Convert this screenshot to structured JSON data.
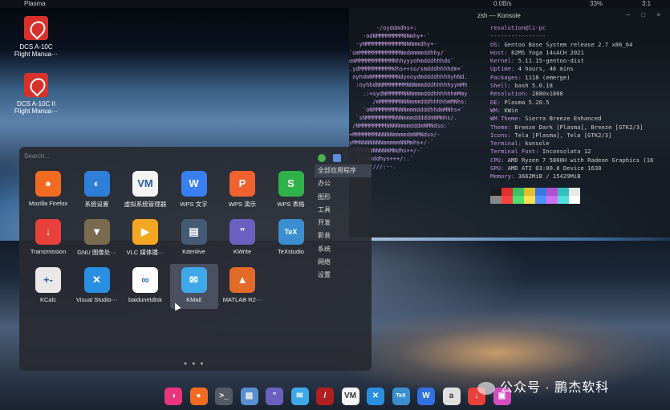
{
  "topbar": {
    "label": "Plasma",
    "stat1": "0.0B/s",
    "stat2": "33%",
    "stat3": "3:1"
  },
  "desktop": {
    "icons": [
      {
        "label1": "DCS A-10C",
        "label2": "Flight Manua···"
      },
      {
        "label1": "DCS A-10C II",
        "label2": "Flight Manua···"
      }
    ]
  },
  "konsole": {
    "title": "zsh — Konsole",
    "window_buttons": "– □ ×",
    "ascii_art": "        -/oyddmdhs+:\n    -odNMMMMMMMMNNmhy+-`\n  -yNMMMMMMMMMMMNNNmmdhy+-\n`omMMMMMMMMMMMMNmdmmmmddhhy/`\nomMMMMMMMMMMMNhhyyyohmdddhhhdo`\n.ydMMMMMMMMMMdhs++so/smdddhhhhdm+`\n oyhdmNMMMMMMMNdyooydmddddhhhhyhNd.\n  :oyhhdNNMMMMMMMNNNmmdddhhhhhyymMh\n    .:+sydNMMMMMNNNmmmdddhhhhhhmMmy\n       /mMMMMMMNNNmmmdddhhhhhmMNhs:\n    `oNMMMMMMMNNNmmmddddhhdmMNhs+`\n  `sNMMMMMMMMNNNmmmdddddmNMmhs/.\n /NMMMMMMMMNNNNmmmdddmNMNdso:`\n+MMMMMMMNNNNNmmmmdmNMNdso/-\nyMMNNNNNNNmmmmmNNMmhs+/-`\n/hMMNNNNNNNNMNdhs++/-`\n`/ohdmmddhys+++/:.`\n  `-//////:--.",
    "info": [
      {
        "k": "resolution@li-pc",
        "v": ""
      },
      {
        "k": "----------------",
        "v": ""
      },
      {
        "k": "OS",
        "v": "Gentoo Base System release 2.7 x86_64"
      },
      {
        "k": "Host",
        "v": "82MS Yoga 14sACH 2021"
      },
      {
        "k": "Kernel",
        "v": "5.11.15-gentoo-dist"
      },
      {
        "k": "Uptime",
        "v": "4 hours, 46 mins"
      },
      {
        "k": "Packages",
        "v": "1118 (emerge)"
      },
      {
        "k": "Shell",
        "v": "bash 5.0.18"
      },
      {
        "k": "Resolution",
        "v": "2880x1800"
      },
      {
        "k": "DE",
        "v": "Plasma 5.20.5"
      },
      {
        "k": "WM",
        "v": "KWin"
      },
      {
        "k": "WM Theme",
        "v": "Sierra Breeze Enhanced"
      },
      {
        "k": "Theme",
        "v": "Breeze Dark [Plasma], Breeze [GTK2/3]"
      },
      {
        "k": "Icons",
        "v": "Tela [Plasma], Tela [GTK2/3]"
      },
      {
        "k": "Terminal",
        "v": "konsole"
      },
      {
        "k": "Terminal Font",
        "v": "Inconsolata 12"
      },
      {
        "k": "CPU",
        "v": "AMD Ryzen 7 5800H with Radeon Graphics (16"
      },
      {
        "k": "GPU",
        "v": "AMD ATI 03:00.0 Device 1638"
      },
      {
        "k": "Memory",
        "v": "3662MiB / 15429MiB"
      }
    ],
    "swatch_colors_top": [
      "#1a1a1a",
      "#e03030",
      "#3cc060",
      "#e0c030",
      "#3a78e0",
      "#b050d0",
      "#30c0c0",
      "#e8e8e8"
    ],
    "swatch_colors_bottom": [
      "#888888",
      "#ff4040",
      "#50e070",
      "#ffe050",
      "#5090ff",
      "#d070f0",
      "#50e0e0",
      "#ffffff"
    ]
  },
  "launcher": {
    "search_placeholder": "Search...",
    "categories": [
      "全部应用程序",
      "办公",
      "图形",
      "工具",
      "开发",
      "影音",
      "系统",
      "网络",
      "设置"
    ],
    "apps": [
      {
        "label": "Mozilla Firefox",
        "icon": "firefox-icon",
        "color": "#f26b21",
        "glyph": "●"
      },
      {
        "label": "系统设置",
        "icon": "system-settings-icon",
        "color": "#2f7fd8",
        "glyph": "◐"
      },
      {
        "label": "虚拟系统管理器",
        "icon": "virt-manager-icon",
        "color": "#f4f4f4",
        "glyph": "VM"
      },
      {
        "label": "WPS 文字",
        "icon": "wps-writer-icon",
        "color": "#3a7ff0",
        "glyph": "W"
      },
      {
        "label": "WPS 演示",
        "icon": "wps-presentation-icon",
        "color": "#f0622f",
        "glyph": "P"
      },
      {
        "label": "WPS 表格",
        "icon": "wps-spreadsheet-icon",
        "color": "#2fb24a",
        "glyph": "S"
      },
      {
        "label": "Transmission",
        "icon": "transmission-icon",
        "color": "#e8403a",
        "glyph": "↓"
      },
      {
        "label": "GNU 图像处···",
        "icon": "gimp-icon",
        "color": "#7a6a50",
        "glyph": "▼"
      },
      {
        "label": "VLC 媒体播···",
        "icon": "vlc-icon",
        "color": "#f5a623",
        "glyph": "▶"
      },
      {
        "label": "Kdenlive",
        "icon": "kdenlive-icon",
        "color": "#455a75",
        "glyph": "▤"
      },
      {
        "label": "KWrite",
        "icon": "kwrite-icon",
        "color": "#6b5fbf",
        "glyph": "”"
      },
      {
        "label": "TeXstudio",
        "icon": "texstudio-icon",
        "color": "#3b8fd0",
        "glyph": "TeX"
      },
      {
        "label": "KCalc",
        "icon": "kcalc-icon",
        "color": "#e9e9e9",
        "glyph": "+-"
      },
      {
        "label": "Visual Studio···",
        "icon": "vscode-icon",
        "color": "#2a8fe0",
        "glyph": "✕"
      },
      {
        "label": "baidunetdisk",
        "icon": "baidunetdisk-icon",
        "color": "#ffffff",
        "glyph": "∞"
      },
      {
        "label": "KMail",
        "icon": "kmail-icon",
        "color": "#3fa8e8",
        "glyph": "✉"
      },
      {
        "label": "MATLAB R2···",
        "icon": "matlab-icon",
        "color": "#e26b2a",
        "glyph": "▲"
      }
    ],
    "page_dots": "● ● ●"
  },
  "dock": [
    {
      "icon": "launcher-menu-icon",
      "color": "#e8357c",
      "glyph": "◑"
    },
    {
      "icon": "firefox-icon",
      "color": "#f26b21",
      "glyph": "●"
    },
    {
      "icon": "terminal-icon",
      "color": "#555b66",
      "glyph": ">_"
    },
    {
      "icon": "file-manager-icon",
      "color": "#5a8fd0",
      "glyph": "▤"
    },
    {
      "icon": "kwrite-icon",
      "color": "#6b5fbf",
      "glyph": "”"
    },
    {
      "icon": "kmail-icon",
      "color": "#3fa8e8",
      "glyph": "✉"
    },
    {
      "icon": "app-icon",
      "color": "#b02020",
      "glyph": "/"
    },
    {
      "icon": "virt-manager-icon",
      "color": "#f4f4f4",
      "glyph": "VM"
    },
    {
      "icon": "vscode-icon",
      "color": "#2a8fe0",
      "glyph": "✕"
    },
    {
      "icon": "texstudio-icon",
      "color": "#3b8fd0",
      "glyph": "TeX"
    },
    {
      "icon": "wps-icon",
      "color": "#3070e0",
      "glyph": "W"
    },
    {
      "icon": "app-a-icon",
      "color": "#e0e0e0",
      "glyph": "a"
    },
    {
      "icon": "transmission-icon",
      "color": "#e8403a",
      "glyph": "↓"
    },
    {
      "icon": "screenshot-icon",
      "color": "#d44ec0",
      "glyph": "▣"
    }
  ],
  "watermark": {
    "text": "公众号 · 鹏杰软科"
  }
}
